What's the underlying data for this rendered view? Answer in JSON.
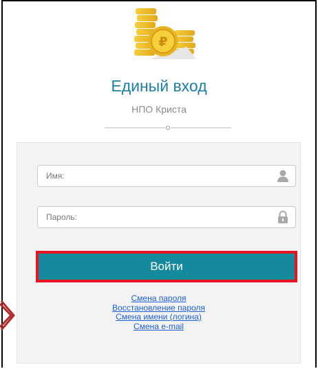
{
  "header": {
    "title": "Единый вход",
    "subtitle": "НПО Криста"
  },
  "form": {
    "username_placeholder": "Имя:",
    "username_value": "",
    "password_placeholder": "Пароль:",
    "password_value": "",
    "login_label": "Войти"
  },
  "links": [
    {
      "label": "Смена пароля"
    },
    {
      "label": "Восстановление пароля"
    },
    {
      "label": "Смена имени (логина)"
    },
    {
      "label": "Смена e-mail"
    }
  ],
  "colors": {
    "accent": "#158a9c",
    "title": "#1a7fa3",
    "highlight_border": "#e8141f",
    "link": "#1a5fd6",
    "coin": "#f2c12e"
  },
  "icons": {
    "logo": "ruble-coins-icon",
    "username": "user-icon",
    "password": "lock-icon",
    "divider": "circle-divider-icon",
    "side_marker": "arrow-right-icon"
  }
}
